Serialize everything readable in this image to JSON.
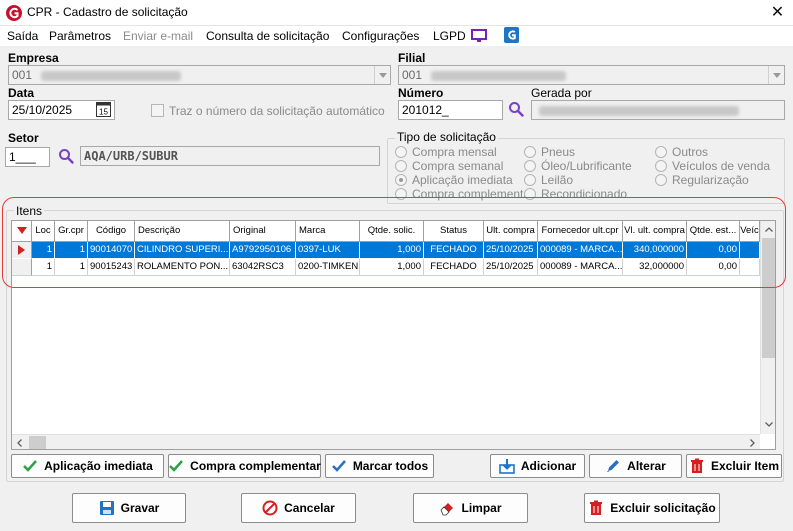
{
  "window": {
    "title": "CPR - Cadastro de solicitação",
    "close_glyph": "✕"
  },
  "menu": {
    "saida": "Saída",
    "parametros": "Parâmetros",
    "enviar_email": "Enviar e-mail",
    "consulta": "Consulta de solicitação",
    "configuracoes": "Configurações",
    "lgpd": "LGPD"
  },
  "form": {
    "empresa_label": "Empresa",
    "empresa_value": "001",
    "filial_label": "Filial",
    "filial_value": "001",
    "data_label": "Data",
    "data_value": "25/10/2025",
    "traz_numero_label": "Traz o número da solicitação automático",
    "numero_label": "Número",
    "numero_value": "201012_",
    "gerada_por_label": "Gerada por",
    "gerada_por_value": "",
    "setor_label": "Setor",
    "setor_code": "1___",
    "setor_desc": "AQA/URB/SUBUR"
  },
  "tipo_solicitacao": {
    "title": "Tipo de solicitação",
    "options": [
      "Compra mensal",
      "Pneus",
      "Outros",
      "Compra semanal",
      "Óleo/Lubrificante",
      "Veículos de venda",
      "Aplicação imediata",
      "Leilão",
      "Regularização",
      "Compra complementar",
      "Recondicionado"
    ],
    "selected": "Aplicação imediata"
  },
  "itens": {
    "title": "Itens",
    "columns": [
      "Loc",
      "Gr.cpr",
      "Código",
      "Descrição",
      "Original",
      "Marca",
      "Qtde. solic.",
      "Status",
      "Ult. compra",
      "Fornecedor ult.cpr",
      "Vl. ult. compra",
      "Qtde. est...",
      "Veíc"
    ],
    "rows": [
      [
        "1",
        "1",
        "90014070",
        "CILINDRO SUPERI...",
        "A9792950106",
        "0397-LUK",
        "1,000",
        "FECHADO",
        "25/10/2025",
        "000089 - MARCA...",
        "340,000000",
        "0,00",
        ""
      ],
      [
        "1",
        "1",
        "90015243",
        "ROLAMENTO PON...",
        "63042RSC3",
        "0200-TIMKEN",
        "1,000",
        "FECHADO",
        "25/10/2025",
        "000089 - MARCA...",
        "32,000000",
        "0,00",
        ""
      ]
    ],
    "selected_row": 0
  },
  "buttons": {
    "aplicacao_imediata": "Aplicação imediata",
    "compra_complementar": "Compra complementar",
    "marcar_todos": "Marcar todos",
    "adicionar": "Adicionar",
    "alterar": "Alterar",
    "excluir_item": "Excluir Item",
    "gravar": "Gravar",
    "cancelar": "Cancelar",
    "limpar": "Limpar",
    "excluir_solicitacao": "Excluir solicitação"
  },
  "colors": {
    "accent": "#0078d7",
    "highlight": "#e33a3a",
    "check_green": "#2ea04a"
  }
}
